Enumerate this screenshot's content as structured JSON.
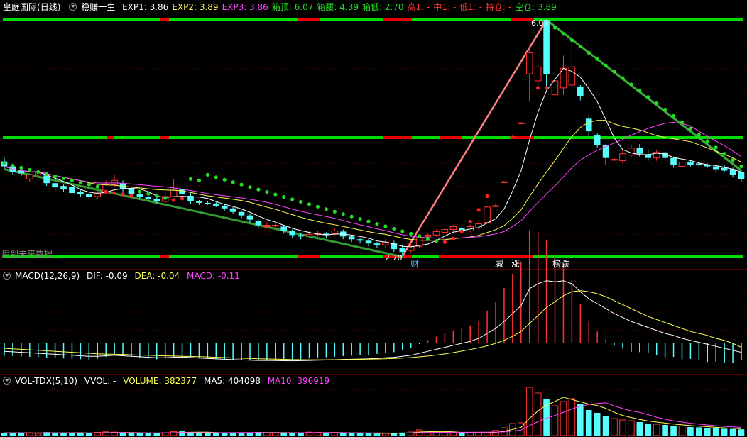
{
  "header": {
    "symbol": "皇庭国际",
    "period": "(日线)",
    "indicator": "稳赚一生",
    "items": [
      {
        "label": "EXP1:",
        "value": "3.86",
        "color": "#ffffff"
      },
      {
        "label": "EXP2:",
        "value": "3.89",
        "color": "#ffff55"
      },
      {
        "label": "EXP3:",
        "value": "3.86",
        "color": "#ff44ff"
      },
      {
        "label": "箱顶:",
        "value": "6.07",
        "color": "#22dd22"
      },
      {
        "label": "箱腰:",
        "value": "4.39",
        "color": "#22dd22"
      },
      {
        "label": "箱低:",
        "value": "2.70",
        "color": "#22dd22"
      },
      {
        "label": "高1:",
        "value": "-",
        "color": "#ff3333"
      },
      {
        "label": "中1:",
        "value": "-",
        "color": "#ff3333"
      },
      {
        "label": "低1:",
        "value": "-",
        "color": "#ff3333"
      },
      {
        "label": "持仓:",
        "value": "-",
        "color": "#ff3333"
      },
      {
        "label": "空仓:",
        "value": "3.89",
        "color": "#22dd22"
      }
    ]
  },
  "macd_header": {
    "title": "MACD(12,26,9)",
    "dif": "DIF: -0.09",
    "dea": "DEA: -0.04",
    "macd": "MACD: -0.11"
  },
  "vol_header": {
    "title": "VOL-TDX(5,10)",
    "vvol": "VVOL: -",
    "volume": "VOLUME: 382377",
    "ma5": "MA5: 404098",
    "ma10": "MA10: 396919"
  },
  "annotations": {
    "high_label": "6.07",
    "low_label": "2.70",
    "future_data": "用到未来数据",
    "events": [
      "财",
      "减",
      "涨",
      "榜跌"
    ]
  },
  "colors": {
    "up": "#ff3333",
    "down": "#55ffff",
    "box_line": "#00dd00",
    "box_red": "#ee0000",
    "wave_up": "#ff8080",
    "wave_down": "#44cc44"
  },
  "chart_data": {
    "type": "candlestick",
    "price_levels": {
      "box_top": 6.07,
      "box_mid": 4.39,
      "box_low": 2.7
    },
    "candles": [
      [
        4.05,
        3.98,
        4.1,
        3.95
      ],
      [
        3.98,
        3.9,
        4.01,
        3.86
      ],
      [
        3.92,
        3.88,
        3.96,
        3.84
      ],
      [
        3.8,
        3.86,
        3.88,
        3.76
      ],
      [
        3.86,
        3.9,
        3.93,
        3.82
      ],
      [
        3.85,
        3.74,
        3.88,
        3.7
      ],
      [
        3.74,
        3.68,
        3.76,
        3.62
      ],
      [
        3.7,
        3.65,
        3.72,
        3.61
      ],
      [
        3.69,
        3.6,
        3.72,
        3.57
      ],
      [
        3.62,
        3.58,
        3.64,
        3.55
      ],
      [
        3.58,
        3.55,
        3.6,
        3.52
      ],
      [
        3.55,
        3.6,
        3.66,
        3.52
      ],
      [
        3.6,
        3.72,
        3.78,
        3.59
      ],
      [
        3.72,
        3.78,
        3.86,
        3.68
      ],
      [
        3.74,
        3.66,
        3.78,
        3.6
      ],
      [
        3.66,
        3.58,
        3.68,
        3.55
      ],
      [
        3.58,
        3.55,
        3.6,
        3.52
      ],
      [
        3.54,
        3.52,
        3.56,
        3.49
      ],
      [
        3.52,
        3.48,
        3.54,
        3.45
      ],
      [
        3.48,
        3.55,
        3.58,
        3.46
      ],
      [
        3.55,
        3.64,
        3.8,
        3.54
      ],
      [
        3.66,
        3.58,
        3.78,
        3.52
      ],
      [
        3.56,
        3.48,
        3.6,
        3.45
      ],
      [
        3.48,
        3.46,
        3.5,
        3.43
      ],
      [
        3.46,
        3.45,
        3.48,
        3.43
      ],
      [
        3.45,
        3.42,
        3.47,
        3.4
      ],
      [
        3.42,
        3.38,
        3.44,
        3.35
      ],
      [
        3.38,
        3.33,
        3.4,
        3.3
      ],
      [
        3.33,
        3.28,
        3.35,
        3.24
      ],
      [
        3.28,
        3.22,
        3.3,
        3.18
      ],
      [
        3.2,
        3.14,
        3.22,
        3.1
      ],
      [
        3.12,
        3.14,
        3.18,
        3.09
      ],
      [
        3.14,
        3.14,
        3.16,
        3.1
      ],
      [
        3.12,
        3.06,
        3.14,
        3.02
      ],
      [
        3.06,
        3.0,
        3.08,
        2.96
      ],
      [
        3.0,
        2.98,
        3.03,
        2.94
      ],
      [
        2.99,
        3.01,
        3.05,
        2.96
      ],
      [
        3.01,
        3.02,
        3.06,
        2.98
      ],
      [
        3.02,
        3.0,
        3.04,
        2.96
      ],
      [
        3.02,
        3.06,
        3.1,
        3.0
      ],
      [
        3.05,
        2.98,
        3.08,
        2.94
      ],
      [
        2.98,
        2.94,
        3.0,
        2.9
      ],
      [
        2.94,
        2.92,
        2.96,
        2.88
      ],
      [
        2.92,
        2.88,
        2.95,
        2.84
      ],
      [
        2.88,
        2.86,
        2.9,
        2.82
      ],
      [
        2.86,
        2.9,
        2.94,
        2.82
      ],
      [
        2.88,
        2.8,
        2.92,
        2.76
      ],
      [
        2.82,
        2.76,
        2.86,
        2.7
      ],
      [
        2.78,
        2.84,
        2.88,
        2.74
      ],
      [
        2.84,
        2.96,
        2.98,
        2.82
      ],
      [
        2.98,
        3.0,
        3.02,
        2.94
      ],
      [
        3.0,
        3.05,
        3.08,
        2.98
      ],
      [
        3.04,
        3.08,
        3.1,
        3.02
      ],
      [
        3.08,
        3.12,
        3.14,
        3.04
      ],
      [
        3.1,
        3.06,
        3.12,
        3.04
      ],
      [
        3.06,
        3.12,
        3.15,
        3.04
      ],
      [
        3.1,
        3.16,
        3.22,
        3.08
      ],
      [
        3.18,
        3.4,
        3.42,
        3.16
      ],
      [
        3.42,
        3.42,
        3.44,
        3.4
      ],
      [
        3.76,
        3.76,
        3.77,
        3.76
      ],
      [
        4.4,
        4.4,
        4.42,
        4.4
      ],
      [
        4.6,
        4.6,
        4.61,
        4.6
      ],
      [
        5.3,
        5.6,
        5.7,
        4.9
      ],
      [
        5.2,
        5.4,
        5.48,
        5.1
      ],
      [
        6.07,
        5.3,
        6.07,
        5.1
      ],
      [
        5.0,
        5.2,
        5.4,
        4.88
      ],
      [
        5.1,
        5.38,
        5.56,
        5.0
      ],
      [
        5.14,
        5.4,
        5.96,
        5.06
      ],
      [
        5.12,
        4.98,
        5.14,
        4.92
      ],
      [
        4.66,
        4.48,
        4.7,
        4.4
      ],
      [
        4.42,
        4.28,
        4.46,
        4.24
      ],
      [
        4.28,
        4.1,
        4.3,
        4.0
      ],
      [
        4.08,
        4.08,
        4.1,
        4.06
      ],
      [
        4.06,
        4.16,
        4.22,
        4.02
      ],
      [
        4.14,
        4.24,
        4.3,
        4.1
      ],
      [
        4.24,
        4.16,
        4.3,
        4.12
      ],
      [
        4.14,
        4.1,
        4.22,
        4.06
      ],
      [
        4.1,
        4.18,
        4.22,
        4.06
      ],
      [
        4.18,
        4.1,
        4.2,
        4.06
      ],
      [
        4.1,
        4.0,
        4.12,
        3.96
      ],
      [
        3.98,
        4.04,
        4.06,
        3.94
      ],
      [
        4.04,
        4.0,
        4.06,
        3.98
      ],
      [
        4.02,
        4.0,
        4.04,
        3.96
      ],
      [
        4.0,
        3.98,
        4.02,
        3.96
      ],
      [
        3.98,
        3.94,
        4.0,
        3.9
      ],
      [
        3.96,
        3.92,
        4.0,
        3.9
      ],
      [
        3.94,
        3.86,
        3.96,
        3.82
      ],
      [
        3.9,
        3.8,
        3.92,
        3.76
      ]
    ],
    "volume": [
      20,
      18,
      22,
      16,
      15,
      24,
      21,
      17,
      19,
      18,
      16,
      22,
      26,
      24,
      18,
      17,
      16,
      15,
      18,
      19,
      28,
      30,
      22,
      20,
      18,
      16,
      18,
      19,
      21,
      22,
      25,
      20,
      18,
      19,
      17,
      20,
      24,
      22,
      19,
      21,
      18,
      17,
      16,
      15,
      14,
      17,
      16,
      21,
      30,
      40,
      26,
      24,
      22,
      20,
      18,
      17,
      19,
      22,
      36,
      55,
      85,
      90,
      340,
      300,
      260,
      210,
      240,
      260,
      220,
      180,
      160,
      140,
      120,
      110,
      105,
      95,
      85,
      80,
      75,
      70,
      68,
      60,
      58,
      55,
      50,
      48,
      46,
      44
    ],
    "macd": {
      "dif": [
        -0.08,
        -0.085,
        -0.09,
        -0.095,
        -0.1,
        -0.105,
        -0.11,
        -0.115,
        -0.12,
        -0.125,
        -0.13,
        -0.13,
        -0.125,
        -0.12,
        -0.125,
        -0.13,
        -0.135,
        -0.14,
        -0.145,
        -0.145,
        -0.14,
        -0.138,
        -0.142,
        -0.148,
        -0.152,
        -0.156,
        -0.16,
        -0.163,
        -0.166,
        -0.17,
        -0.172,
        -0.172,
        -0.173,
        -0.175,
        -0.176,
        -0.174,
        -0.172,
        -0.17,
        -0.168,
        -0.165,
        -0.162,
        -0.16,
        -0.158,
        -0.155,
        -0.15,
        -0.145,
        -0.14,
        -0.13,
        -0.12,
        -0.1,
        -0.08,
        -0.06,
        -0.04,
        -0.02,
        0.0,
        0.02,
        0.05,
        0.1,
        0.15,
        0.22,
        0.3,
        0.38,
        0.55,
        0.6,
        0.63,
        0.62,
        0.63,
        0.6,
        0.52,
        0.45,
        0.4,
        0.35,
        0.3,
        0.26,
        0.22,
        0.19,
        0.16,
        0.13,
        0.1,
        0.08,
        0.05,
        0.03,
        0.01,
        -0.01,
        -0.03,
        -0.05,
        -0.07,
        -0.09
      ],
      "dea": [
        -0.05,
        -0.055,
        -0.06,
        -0.065,
        -0.07,
        -0.075,
        -0.08,
        -0.085,
        -0.09,
        -0.095,
        -0.1,
        -0.105,
        -0.108,
        -0.11,
        -0.112,
        -0.115,
        -0.118,
        -0.12,
        -0.123,
        -0.126,
        -0.128,
        -0.13,
        -0.132,
        -0.134,
        -0.137,
        -0.14,
        -0.143,
        -0.146,
        -0.149,
        -0.152,
        -0.155,
        -0.157,
        -0.159,
        -0.161,
        -0.163,
        -0.164,
        -0.165,
        -0.165,
        -0.165,
        -0.164,
        -0.163,
        -0.162,
        -0.161,
        -0.159,
        -0.157,
        -0.155,
        -0.152,
        -0.148,
        -0.143,
        -0.136,
        -0.128,
        -0.118,
        -0.106,
        -0.093,
        -0.078,
        -0.062,
        -0.045,
        -0.025,
        0.0,
        0.03,
        0.07,
        0.12,
        0.2,
        0.28,
        0.36,
        0.42,
        0.48,
        0.52,
        0.53,
        0.52,
        0.5,
        0.47,
        0.43,
        0.39,
        0.35,
        0.31,
        0.27,
        0.24,
        0.21,
        0.18,
        0.15,
        0.12,
        0.1,
        0.08,
        0.05,
        0.03,
        0.0,
        -0.04
      ]
    }
  }
}
